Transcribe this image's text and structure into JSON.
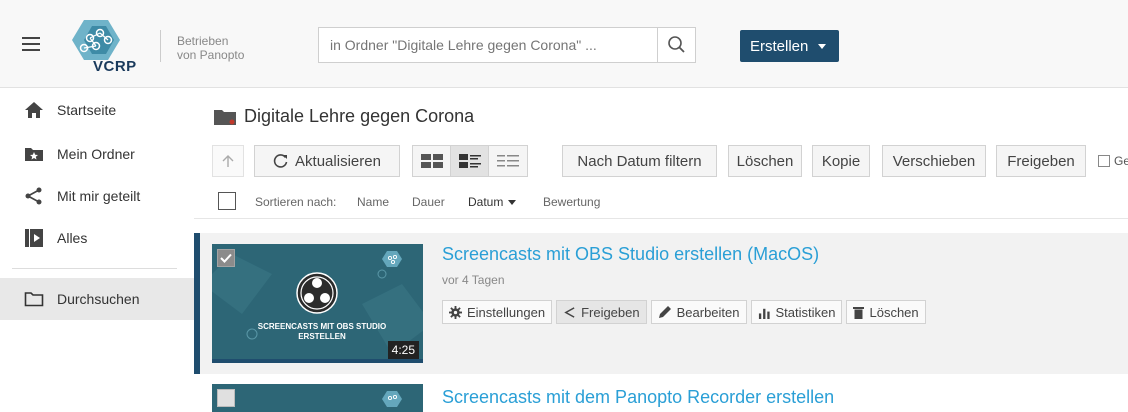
{
  "header": {
    "logo_text": "VCRP",
    "powered_line1": "Betrieben",
    "powered_line2": "von Panopto",
    "search_placeholder": "in Ordner \"Digitale Lehre gegen Corona\" ...",
    "create_label": "Erstellen"
  },
  "sidebar": {
    "items": [
      {
        "label": "Startseite",
        "icon": "home-icon"
      },
      {
        "label": "Mein Ordner",
        "icon": "folder-star-icon"
      },
      {
        "label": "Mit mir geteilt",
        "icon": "share-icon"
      },
      {
        "label": "Alles",
        "icon": "play-box-icon"
      },
      {
        "label": "Durchsuchen",
        "icon": "folder-icon"
      }
    ]
  },
  "main": {
    "folder_title": "Digitale Lehre gegen Corona",
    "toolbar": {
      "refresh": "Aktualisieren",
      "filter_date": "Nach Datum filtern",
      "delete": "Löschen",
      "copy": "Kopie",
      "move": "Verschieben",
      "share": "Freigeben",
      "scheduled": "Gepl"
    },
    "sort": {
      "label": "Sortieren nach:",
      "name": "Name",
      "duration": "Dauer",
      "date": "Datum",
      "rating": "Bewertung"
    },
    "sessions": [
      {
        "title": "Screencasts mit OBS Studio erstellen (MacOS)",
        "date": "vor 4 Tagen",
        "thumb_text": "SCREENCASTS MIT OBS STUDIO ERSTELLEN",
        "duration": "4:25",
        "actions": {
          "settings": "Einstellungen",
          "share": "Freigeben",
          "edit": "Bearbeiten",
          "stats": "Statistiken",
          "delete": "Löschen"
        }
      },
      {
        "title": "Screencasts mit dem Panopto Recorder erstellen"
      }
    ]
  },
  "colors": {
    "brand_dark": "#1f4d6e",
    "link": "#2a9fd6",
    "thumb_bg": "#2d6676"
  }
}
